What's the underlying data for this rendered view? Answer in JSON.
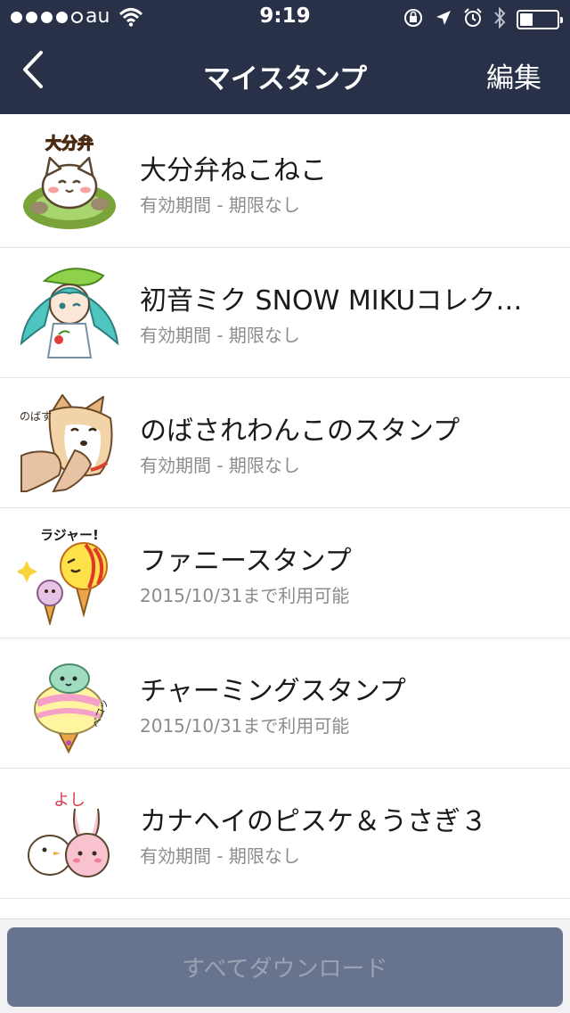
{
  "status_bar": {
    "carrier": "au",
    "time": "9:19",
    "signal_bars": 4,
    "signal_max": 5,
    "battery_level": 0.35,
    "icons": [
      "wifi-icon",
      "rotation-lock-icon",
      "location-arrow-icon",
      "alarm-icon",
      "bluetooth-icon",
      "battery-icon"
    ]
  },
  "nav": {
    "back_icon": "chevron-left-icon",
    "title": "マイスタンプ",
    "edit_label": "編集"
  },
  "stickers": [
    {
      "name": "大分弁ねこねこ",
      "subtitle": "有効期間 - 期限なし",
      "thumb": "cat-onsen-sticker",
      "thumb_caption": "大分弁"
    },
    {
      "name": "初音ミク SNOW MIKUコレクション",
      "subtitle": "有効期間 - 期限なし",
      "thumb": "snow-miku-sticker"
    },
    {
      "name": "のばされわんこのスタンプ",
      "subtitle": "有効期間 - 期限なし",
      "thumb": "stretched-dog-sticker",
      "thumb_caption": "のばす"
    },
    {
      "name": "ファニースタンプ",
      "subtitle": "2015/10/31まで利用可能",
      "thumb": "funny-icecream-sticker",
      "thumb_caption": "ラジャー!"
    },
    {
      "name": "チャーミングスタンプ",
      "subtitle": "2015/10/31まで利用可能",
      "thumb": "charming-icecream-sticker",
      "thumb_caption": "ペコッ"
    },
    {
      "name": "カナヘイのピスケ＆うさぎ３",
      "subtitle": "有効期間 - 期限なし",
      "thumb": "piske-usagi-sticker",
      "thumb_caption": "よし"
    }
  ],
  "footer": {
    "download_all_label": "すべてダウンロード"
  },
  "colors": {
    "nav_background": "#283148",
    "footer_background": "#f2f2f4",
    "download_button": "#68748e",
    "download_text": "#9aa2b4",
    "subtitle_text": "#8c8c8c"
  }
}
